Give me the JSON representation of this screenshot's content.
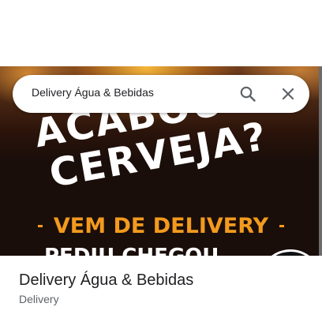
{
  "search": {
    "query": "Delivery Água & Bebidas",
    "search_icon": "search-icon",
    "close_icon": "close-icon"
  },
  "hero": {
    "headline_line1": "ACABOU A",
    "headline_line2": "CERVEJA?",
    "subheadline": "VEM DE DELIVERY",
    "tagline": "PEDIU CHEGOU",
    "accent_color": "#f39a1e",
    "background_color": "#1a0e0a"
  },
  "place": {
    "name": "Delivery Água & Bebidas",
    "category": "Delivery"
  }
}
